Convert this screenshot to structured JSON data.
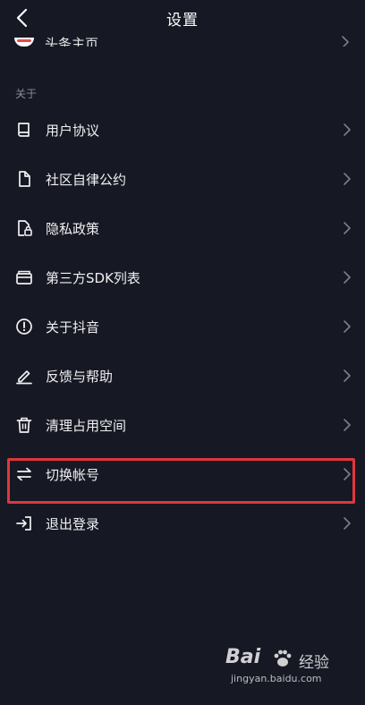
{
  "header": {
    "title": "设置"
  },
  "partial_item": {
    "label": "头条主页"
  },
  "section": {
    "title": "关于"
  },
  "menu": {
    "items": [
      {
        "label": "用户协议",
        "icon": "book-icon"
      },
      {
        "label": "社区自律公约",
        "icon": "document-icon"
      },
      {
        "label": "隐私政策",
        "icon": "privacy-lock-icon"
      },
      {
        "label": "第三方SDK列表",
        "icon": "card-stack-icon"
      },
      {
        "label": "关于抖音",
        "icon": "info-exclamation-icon"
      },
      {
        "label": "反馈与帮助",
        "icon": "pencil-icon"
      },
      {
        "label": "清理占用空间",
        "icon": "trash-icon"
      },
      {
        "label": "切换帐号",
        "icon": "switch-arrows-icon"
      },
      {
        "label": "退出登录",
        "icon": "logout-icon"
      }
    ]
  },
  "highlight": {
    "color": "#e0363d",
    "target": "切换帐号"
  },
  "watermark": {
    "brand": "Bai",
    "product": "经验",
    "url": "jingyan.baidu.com"
  },
  "colors": {
    "background": "#161823",
    "text": "#f0f0f2",
    "muted": "#8a8b91",
    "highlight": "#e0363d"
  }
}
